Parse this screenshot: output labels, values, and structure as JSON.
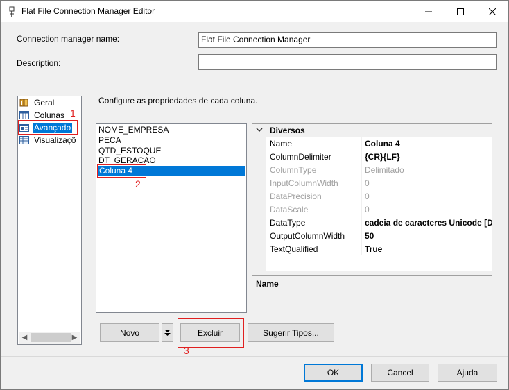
{
  "window": {
    "title": "Flat File Connection Manager Editor"
  },
  "fields": {
    "name_label": "Connection manager name:",
    "name_value": "Flat File Connection Manager",
    "description_label": "Description:",
    "description_value": ""
  },
  "nav": {
    "items": [
      {
        "label": "Geral",
        "icon": "general-icon"
      },
      {
        "label": "Colunas",
        "icon": "columns-icon"
      },
      {
        "label": "Avançado",
        "icon": "advanced-icon",
        "selected": true
      },
      {
        "label": "Visualizaçõ",
        "icon": "preview-icon"
      }
    ]
  },
  "main": {
    "instruction": "Configure as propriedades de cada coluna.",
    "columns": [
      "NOME_EMPRESA",
      "PECA",
      "QTD_ESTOQUE",
      "DT_GERACAO",
      "Coluna 4"
    ],
    "selected_column": "Coluna 4"
  },
  "properties": {
    "category": "Diversos",
    "rows": [
      {
        "name": "Name",
        "value": "Coluna 4",
        "disabled": false,
        "bold": true
      },
      {
        "name": "ColumnDelimiter",
        "value": "{CR}{LF}",
        "disabled": false,
        "bold": true
      },
      {
        "name": "ColumnType",
        "value": "Delimitado",
        "disabled": true,
        "bold": false
      },
      {
        "name": "InputColumnWidth",
        "value": "0",
        "disabled": true,
        "bold": false
      },
      {
        "name": "DataPrecision",
        "value": "0",
        "disabled": true,
        "bold": false
      },
      {
        "name": "DataScale",
        "value": "0",
        "disabled": true,
        "bold": false
      },
      {
        "name": "DataType",
        "value": "cadeia de caracteres Unicode [DT",
        "disabled": false,
        "bold": true
      },
      {
        "name": "OutputColumnWidth",
        "value": "50",
        "disabled": false,
        "bold": true
      },
      {
        "name": "TextQualified",
        "value": "True",
        "disabled": false,
        "bold": true
      }
    ],
    "description_title": "Name"
  },
  "buttons": {
    "novo": "Novo",
    "excluir": "Excluir",
    "sugerir": "Sugerir Tipos...",
    "ok": "OK",
    "cancel": "Cancel",
    "ajuda": "Ajuda"
  },
  "annotations": [
    "1",
    "2",
    "3"
  ],
  "colors": {
    "selection": "#0078d7",
    "annotation": "#e02020"
  }
}
